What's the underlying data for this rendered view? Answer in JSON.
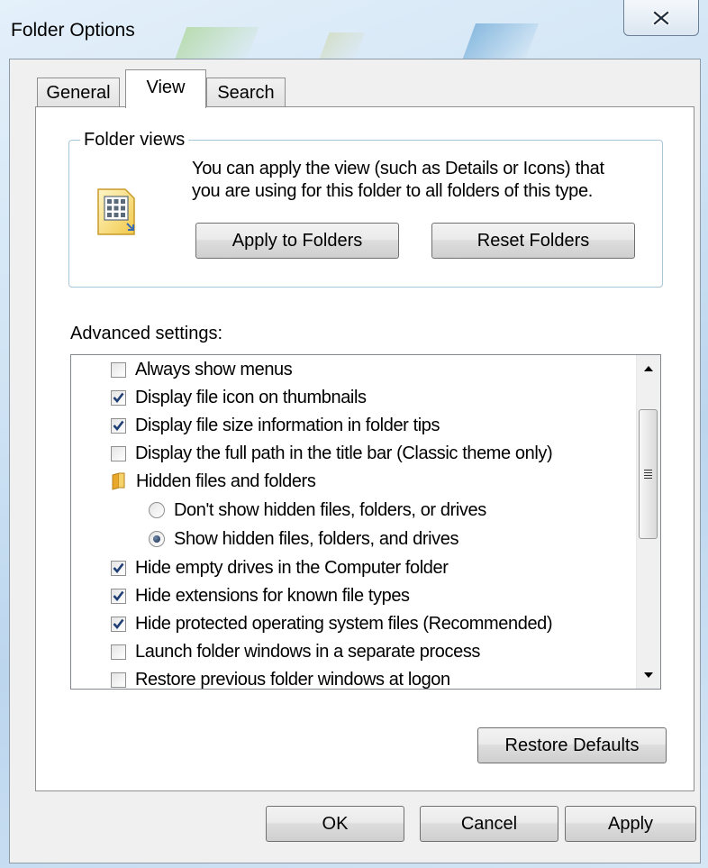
{
  "window": {
    "title": "Folder Options"
  },
  "tabs": [
    {
      "label": "General",
      "selected": false
    },
    {
      "label": "View",
      "selected": true
    },
    {
      "label": "Search",
      "selected": false
    }
  ],
  "folder_views": {
    "group_title": "Folder views",
    "description_line1": "You can apply the view (such as Details or Icons) that",
    "description_line2": "you are using for this folder to all folders of this type.",
    "apply_button": "Apply to Folders",
    "reset_button": "Reset Folders"
  },
  "advanced": {
    "label": "Advanced settings:",
    "items": [
      {
        "type": "checkbox",
        "label": "Always show menus",
        "checked": false
      },
      {
        "type": "checkbox",
        "label": "Display file icon on thumbnails",
        "checked": true
      },
      {
        "type": "checkbox",
        "label": "Display file size information in folder tips",
        "checked": true
      },
      {
        "type": "checkbox",
        "label": "Display the full path in the title bar (Classic theme only)",
        "checked": false
      },
      {
        "type": "folder",
        "label": "Hidden files and folders"
      },
      {
        "type": "radio",
        "label": "Don't show hidden files, folders, or drives",
        "checked": false
      },
      {
        "type": "radio",
        "label": "Show hidden files, folders, and drives",
        "checked": true
      },
      {
        "type": "checkbox",
        "label": "Hide empty drives in the Computer folder",
        "checked": true
      },
      {
        "type": "checkbox",
        "label": "Hide extensions for known file types",
        "checked": true
      },
      {
        "type": "checkbox",
        "label": "Hide protected operating system files (Recommended)",
        "checked": true
      },
      {
        "type": "checkbox",
        "label": "Launch folder windows in a separate process",
        "checked": false
      },
      {
        "type": "checkbox",
        "label": "Restore previous folder windows at logon",
        "checked": false
      }
    ]
  },
  "buttons": {
    "restore_defaults": "Restore Defaults",
    "ok": "OK",
    "cancel": "Cancel",
    "apply": "Apply"
  },
  "icons": {
    "close": "close-x-icon",
    "folder_views": "folder-views-icon",
    "folder": "folder-icon"
  },
  "colors": {
    "dialog_background": "#f0f0f0",
    "group_border": "#a8c6d8",
    "check_mark": "#1f3f74"
  }
}
